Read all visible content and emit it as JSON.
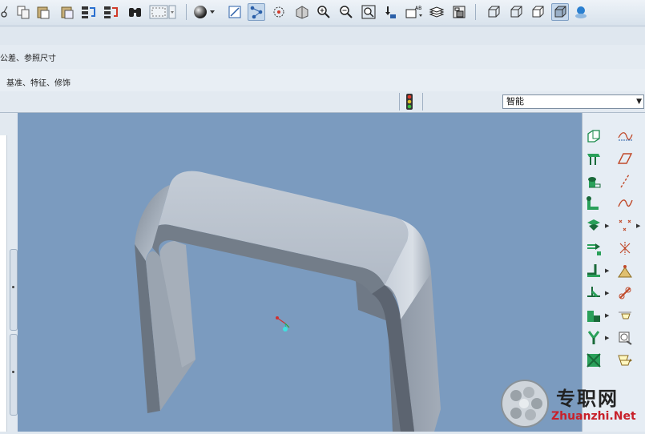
{
  "toolbar": {
    "icons": [
      "cut-icon",
      "copy-icon",
      "paste-icon",
      "paste-special-icon",
      "regenerate-icon",
      "regenerate-manager-icon",
      "find-icon",
      "select-box-icon",
      "shading-sphere-icon",
      "repaint-icon",
      "orient-icon",
      "spin-center-icon",
      "named-views-icon",
      "zoom-in-icon",
      "zoom-out-icon",
      "refit-icon",
      "reorient-icon",
      "annotation-icon",
      "layers-icon",
      "view-manager-icon",
      "wireframe-icon",
      "hidden-line-icon",
      "no-hidden-icon",
      "shading-icon",
      "model-tree-icon"
    ]
  },
  "ribbon": {
    "row1_text": "公差、参照尺寸",
    "row2_text": "基准、特征、修饰"
  },
  "filter": {
    "selected": "智能"
  },
  "right_toolbar": {
    "icons": [
      "datum-plane-icon",
      "sketched-curve-icon",
      "extrude-icon",
      "datum-plane-display-icon",
      "revolve-icon",
      "datum-axis-icon",
      "sweep-icon",
      "datum-curve-icon",
      "blend-icon",
      "datum-point-icon",
      "hole-icon",
      "csys-icon",
      "shell-icon",
      "analysis-icon",
      "rib-icon",
      "mirror-icon",
      "draft-icon",
      "copy-feature-icon",
      "round-icon",
      "pattern-icon",
      "chamfer-icon",
      "merge-icon",
      "trim-icon",
      "intersect-icon"
    ]
  },
  "watermark": {
    "cn": "专职网",
    "en": "Zhuanzhi.Net"
  }
}
